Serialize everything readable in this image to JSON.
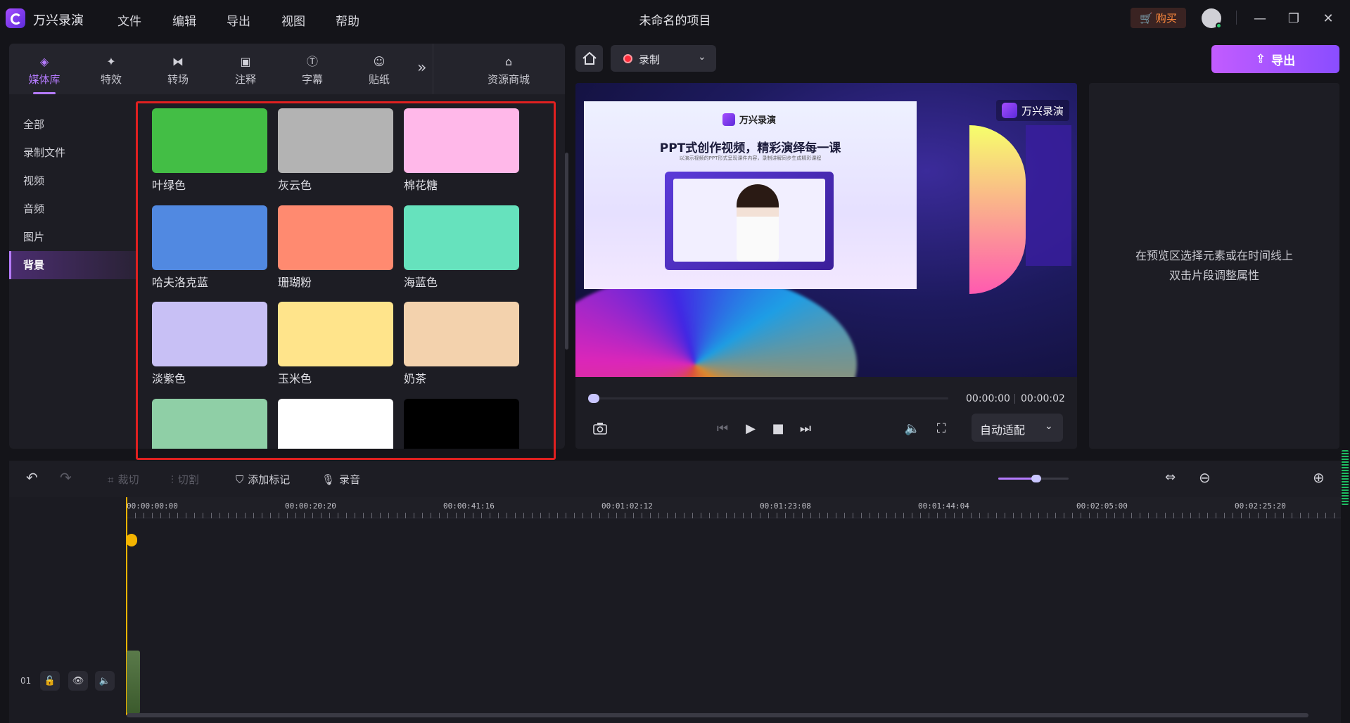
{
  "app": {
    "name": "万兴录演",
    "project_title": "未命名的项目"
  },
  "menu": [
    "文件",
    "编辑",
    "导出",
    "视图",
    "帮助"
  ],
  "titlebar": {
    "buy_label": "购买"
  },
  "tabs": [
    {
      "label": "媒体库",
      "icon": "layers-icon",
      "active": true
    },
    {
      "label": "特效",
      "icon": "sparkle-icon",
      "active": false
    },
    {
      "label": "转场",
      "icon": "transition-icon",
      "active": false
    },
    {
      "label": "注释",
      "icon": "annotation-icon",
      "active": false
    },
    {
      "label": "字幕",
      "icon": "subtitle-icon",
      "active": false
    },
    {
      "label": "贴纸",
      "icon": "sticker-icon",
      "active": false
    }
  ],
  "store_tab": {
    "label": "资源商城"
  },
  "sidebar": {
    "items": [
      {
        "label": "全部",
        "active": false
      },
      {
        "label": "录制文件",
        "active": false
      },
      {
        "label": "视频",
        "active": false
      },
      {
        "label": "音频",
        "active": false
      },
      {
        "label": "图片",
        "active": false
      },
      {
        "label": "背景",
        "active": true
      }
    ]
  },
  "swatches": [
    {
      "label": "叶绿色",
      "color": "#43be45"
    },
    {
      "label": "灰云色",
      "color": "#b3b3b3"
    },
    {
      "label": "棉花糖",
      "color": "#ffb8e9"
    },
    {
      "label": "哈夫洛克蓝",
      "color": "#5189e1"
    },
    {
      "label": "珊瑚粉",
      "color": "#ff8a70"
    },
    {
      "label": "海蓝色",
      "color": "#66e2bd"
    },
    {
      "label": "淡紫色",
      "color": "#c8c0f5"
    },
    {
      "label": "玉米色",
      "color": "#ffe48b"
    },
    {
      "label": "奶茶",
      "color": "#f3d2ad"
    },
    {
      "label": "",
      "color": "#8fcfa6"
    },
    {
      "label": "",
      "color": "#ffffff"
    },
    {
      "label": "",
      "color": "#000000"
    }
  ],
  "preview": {
    "record_label": "录制",
    "export_label": "导出",
    "watermark": "万兴录演",
    "slide": {
      "brand": "万兴录演",
      "title": "PPT式创作视频，精彩演绎每一课",
      "subtitle": "以演示视频的PPT形式呈现课件内容，录制讲解同步生成精彩课程"
    },
    "time_current": "00:00:00",
    "time_total": "00:00:02",
    "fit_label": "自动适配",
    "progress": 0.0
  },
  "properties": {
    "hint_line1": "在预览区选择元素或在时间线上",
    "hint_line2": "双击片段调整属性"
  },
  "timeline_tools": [
    {
      "label": "裁切",
      "icon": "crop-icon",
      "enabled": false
    },
    {
      "label": "切割",
      "icon": "split-icon",
      "enabled": false
    },
    {
      "label": "添加标记",
      "icon": "marker-icon",
      "enabled": true
    },
    {
      "label": "录音",
      "icon": "microphone-icon",
      "enabled": true
    }
  ],
  "timeline": {
    "zoom": 0.54,
    "ruler_labels": [
      "00:00:00:00",
      "00:00:20:20",
      "00:00:41:16",
      "00:01:02:12",
      "00:01:23:08",
      "00:01:44:04",
      "00:02:05:00",
      "00:02:25:20"
    ],
    "track_label": "01"
  }
}
